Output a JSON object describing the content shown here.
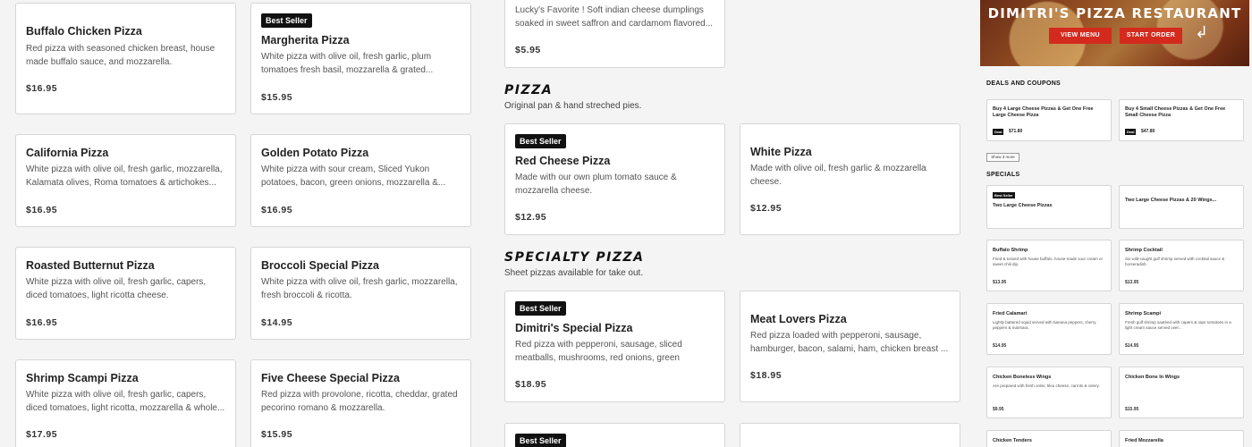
{
  "badge_label": "Best Seller",
  "col1": [
    {
      "name": "Buffalo Chicken Pizza",
      "desc": "Red pizza with seasoned chicken breast, house made buffalo sauce, and mozzarella.",
      "price": "$16.95"
    },
    {
      "name": "California Pizza",
      "desc": "White pizza with olive oil, fresh garlic, mozzarella, Kalamata olives, Roma tomatoes & artichokes...",
      "price": "$16.95"
    },
    {
      "name": "Roasted Butternut Pizza",
      "desc": "White pizza with olive oil, fresh garlic, capers, diced tomatoes, light ricotta cheese.",
      "price": "$16.95"
    },
    {
      "name": "Shrimp Scampi Pizza",
      "desc": "White pizza with olive oil, fresh garlic, capers, diced tomatoes, light ricotta, mozzarella & whole...",
      "price": "$17.95"
    }
  ],
  "col2": [
    {
      "name": "Margherita Pizza",
      "desc": "White pizza with olive oil, fresh garlic, plum tomatoes fresh basil, mozzarella & grated...",
      "price": "$15.95",
      "best_seller": true
    },
    {
      "name": "Golden Potato Pizza",
      "desc": "White pizza with sour cream, Sliced Yukon potatoes, bacon, green onions, mozzarella &...",
      "price": "$16.95"
    },
    {
      "name": "Broccoli Special Pizza",
      "desc": "White pizza with olive oil, fresh garlic, mozzarella, fresh broccoli & ricotta.",
      "price": "$14.95"
    },
    {
      "name": "Five Cheese Special Pizza",
      "desc": "Red pizza with provolone, ricotta, cheddar, grated pecorino romano & mozzarella.",
      "price": "$15.95"
    }
  ],
  "top_card": {
    "desc": "Lucky's Favorite ! Soft indian cheese dumplings soaked in sweet saffron and cardamom flavored...",
    "price": "$5.95"
  },
  "pizza_section": {
    "title": "PIZZA",
    "subtitle": "Original pan & hand streched pies."
  },
  "pizza_items": [
    {
      "name": "Red Cheese Pizza",
      "desc": "Made with our own plum tomato sauce & mozzarella cheese.",
      "price": "$12.95",
      "best_seller": true
    },
    {
      "name": "White Pizza",
      "desc": "Made with olive oil, fresh garlic & mozzarella cheese.",
      "price": "$12.95"
    }
  ],
  "specialty_section": {
    "title": "SPECIALTY PIZZA",
    "subtitle": "Sheet pizzas available for take out."
  },
  "specialty_items": [
    {
      "name": "Dimitri's Special Pizza",
      "desc": "Red pizza with pepperoni, sausage, sliced meatballs, mushrooms, red onions, green pepper...",
      "price": "$18.95",
      "best_seller": true
    },
    {
      "name": "Meat Lovers Pizza",
      "desc": "Red pizza loaded with pepperoni, sausage, hamburger, bacon, salami, ham, chicken breast ...",
      "price": "$18.95"
    }
  ],
  "hero": {
    "title": "DIMITRI'S PIZZA RESTAURANT",
    "view_menu": "VIEW MENU",
    "start_order": "START ORDER"
  },
  "deals": {
    "heading": "DEALS AND COUPONS",
    "tag": "Deal",
    "items": [
      {
        "name": "Buy 4 Large Cheese Pizzas & Get One Free Large Cheese Pizza",
        "price": "$71.80"
      },
      {
        "name": "Buy 4 Small Cheese Pizzas & Get One Free Small Cheese Pizza",
        "price": "$47.80"
      }
    ],
    "show_more": "Show 3 more"
  },
  "specials": {
    "heading": "SPECIALS",
    "items": [
      {
        "name": "Two Large Cheese Pizzas",
        "best_seller": true
      },
      {
        "name": "Two Large Cheese Pizzas & 20 Wings..."
      }
    ]
  },
  "apps": [
    {
      "name": "Buffalo Shrimp",
      "desc": "Fried & tossed with house buffalo, house-made sour cream or sweet chili dip.",
      "price": "$13.95"
    },
    {
      "name": "Shrimp Cocktail",
      "desc": "Six wild-caught gulf shrimp served with cocktail sauce & horseradish.",
      "price": "$13.95"
    },
    {
      "name": "Fried Calamari",
      "desc": "Lightly battered squid served with banana peppers, cherry peppers & marinara.",
      "price": "$14.95"
    },
    {
      "name": "Shrimp Scampi",
      "desc": "Fresh gulf shrimp sautéed with capers & rape tomatoes in a light cream sauce served over...",
      "price": "$14.95"
    },
    {
      "name": "Chicken Boneless Wings",
      "desc": "Are prepared with fresh order, bleu cheese, carrots & celery.",
      "price": "$9.95"
    },
    {
      "name": "Chicken Bone In Wings",
      "desc": "",
      "price": "$15.95"
    },
    {
      "name": "Chicken Tenders",
      "desc": "",
      "price": ""
    },
    {
      "name": "Fried Mozzarella",
      "desc": "",
      "price": ""
    }
  ]
}
